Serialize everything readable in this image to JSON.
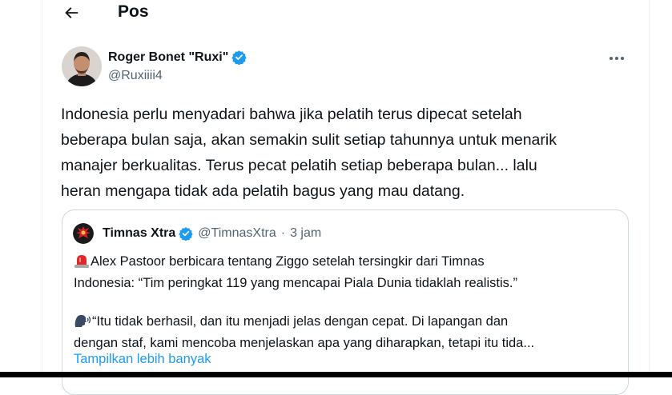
{
  "header": {
    "title": "Pos",
    "back_icon": "arrow-left-icon"
  },
  "post": {
    "author_name": "Roger Bonet \"Ruxi\"",
    "author_handle": "@Ruxiiii4",
    "verified": true,
    "lines": [
      "Indonesia perlu menyadari bahwa jika pelatih terus dipecat setelah",
      "beberapa bulan saja, akan semakin sulit setiap tahunnya untuk menarik",
      "manajer berkualitas. Terus pecat pelatih setiap beberapa bulan... lalu",
      "heran mengapa tidak ada pelatih bagus yang mau datang."
    ]
  },
  "quote": {
    "author_name": "Timnas Xtra",
    "author_handle": "@TimnasXtra",
    "separator": "·",
    "time": "3 jam",
    "verified": true,
    "lines": [
      "Alex Pastoor berbicara tentang Ziggo setelah tersingkir dari Timnas",
      "Indonesia: “Tim peringkat 119 yang mencapai Piala Dunia tidaklah realistis.”",
      "",
      "“Itu tidak berhasil, dan itu menjadi jelas dengan cepat. Di lapangan dan",
      "dengan staf, kami mencoba menjelaskan apa yang diharapkan, tetapi itu tida..."
    ],
    "show_more": "Tampilkan lebih banyak"
  },
  "colors": {
    "accent": "#1d9bf0",
    "secondary_text": "#536471",
    "border": "#cfd9de"
  }
}
